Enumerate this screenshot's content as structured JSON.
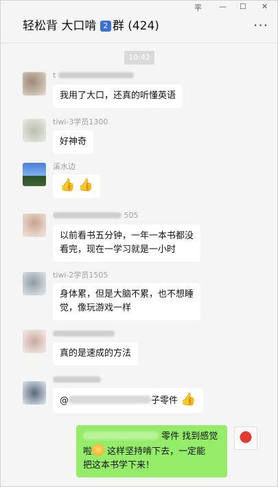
{
  "window": {
    "title": "轻松背 大口啃",
    "badge_number": "2",
    "title_suffix": "群 (424)",
    "controls": {
      "pin": "平",
      "minimize": "—",
      "maximize": "☐",
      "close": "✕"
    },
    "more_label": "···"
  },
  "chat": {
    "timestamp": "10:42",
    "messages": [
      {
        "sender": "t",
        "text": "我用了大口，还真的听懂英语"
      },
      {
        "sender": "tiwi-3学员1300",
        "text": "好神奇"
      },
      {
        "sender": "溪水边",
        "text": ""
      },
      {
        "sender": "505",
        "text": "以前看书五分钟，一年一本书都没看完，现在一学习就是一小时"
      },
      {
        "sender": "tiwi-2学员1505",
        "text": "身体累，但是大脑不累，也不想睡觉，像玩游戏一样"
      },
      {
        "sender": "",
        "text": "真的是速成的方法"
      },
      {
        "sender": "",
        "text_prefix": "@",
        "text_suffix": "子零件"
      },
      {
        "sender": "self",
        "text_prefix": "零件 找到感觉",
        "line2": "啦",
        "line2b": "这样坚持啃下去，一定能",
        "line3": "把这本书学下来！"
      }
    ],
    "icons": {
      "thumbs_up": "👍",
      "face": "😄"
    }
  },
  "colors": {
    "self_bubble": "#95ec69",
    "other_bubble": "#ffffff",
    "background": "#f5f5f5"
  }
}
